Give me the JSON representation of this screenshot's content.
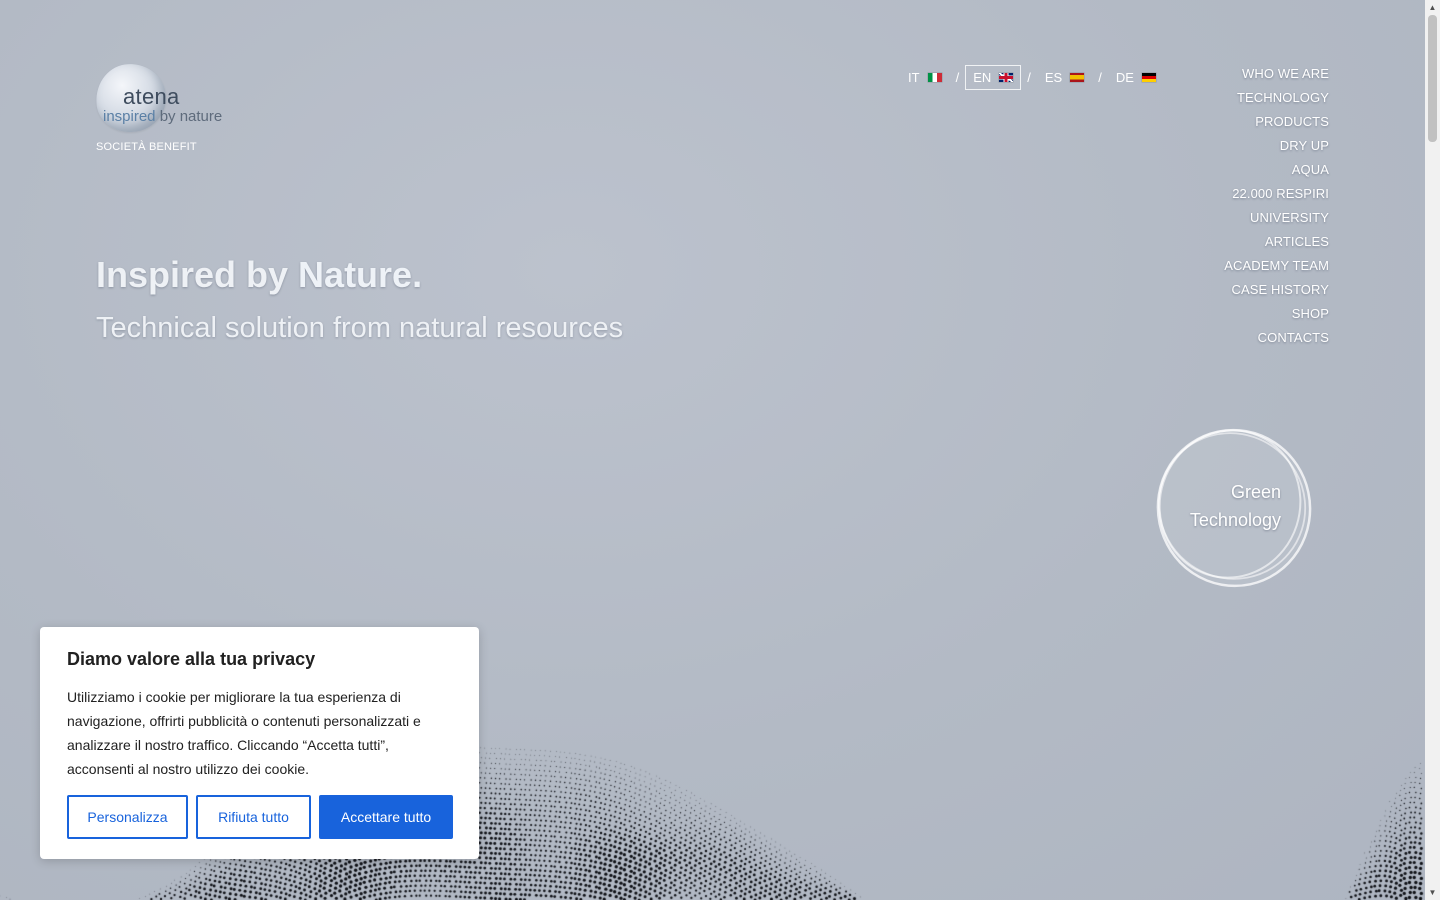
{
  "logo": {
    "name": "atena",
    "tagline_highlight": "inspired",
    "tagline_rest": " by nature",
    "subtitle": "SOCIETÀ BENEFIT"
  },
  "languages": [
    {
      "code": "IT",
      "flag": "flag-it",
      "active": false
    },
    {
      "code": "EN",
      "flag": "flag-gb",
      "active": true
    },
    {
      "code": "ES",
      "flag": "flag-es",
      "active": false
    },
    {
      "code": "DE",
      "flag": "flag-de",
      "active": false
    }
  ],
  "language_separator": "/",
  "nav": {
    "items": [
      "WHO WE ARE",
      "TECHNOLOGY",
      "PRODUCTS",
      "DRY UP",
      "AQUA",
      "22.000 RESPIRI",
      "UNIVERSITY",
      "ARTICLES",
      "ACADEMY TEAM",
      "CASE HISTORY",
      "SHOP",
      "CONTACTS"
    ]
  },
  "hero": {
    "title_part1": "Inspired by ",
    "title_part2": "Nature.",
    "subtitle": "Technical solution from natural resources"
  },
  "badge": {
    "line1": "Green",
    "line2": "Technology"
  },
  "cookie": {
    "title": "Diamo valore alla tua privacy",
    "text": "Utilizziamo i cookie per migliorare la tua esperienza di navigazione, offrirti pubblicità o contenuti personalizzati e analizzare il nostro traffico. Cliccando “Accetta tutti”, acconsenti al nostro utilizzo dei cookie.",
    "customize_label": "Personalizza",
    "reject_label": "Rifiuta tutto",
    "accept_label": "Accettare tutto"
  },
  "colors": {
    "background": "#b3bac5",
    "accent": "#1863dc",
    "dots": "#0d0f14"
  }
}
